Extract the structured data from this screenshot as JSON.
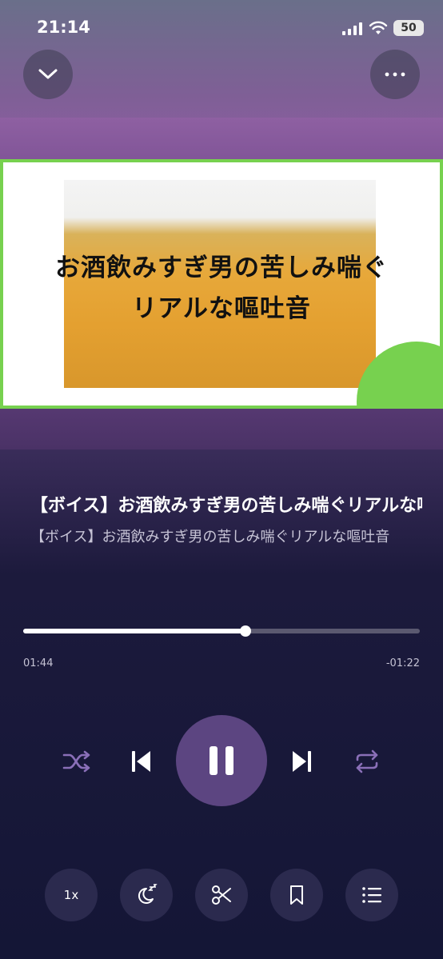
{
  "status_bar": {
    "time": "21:14",
    "battery": "50"
  },
  "artwork": {
    "line1": "お酒飲みすぎ男の苦しみ喘ぐ",
    "line2": "リアルな嘔吐音"
  },
  "track": {
    "title": "【ボイス】お酒飲みすぎ男の苦しみ喘ぐリアルな嘔吐音",
    "subtitle": "【ボイス】お酒飲みすぎ男の苦しみ喘ぐリアルな嘔吐音"
  },
  "progress": {
    "elapsed": "01:44",
    "remaining": "-01:22",
    "fraction": 0.56
  },
  "controls": {
    "speed_label": "1x"
  },
  "colors": {
    "accent": "#5c4581",
    "art_border": "#77d14f",
    "control_inactive": "#8a6fb8"
  }
}
